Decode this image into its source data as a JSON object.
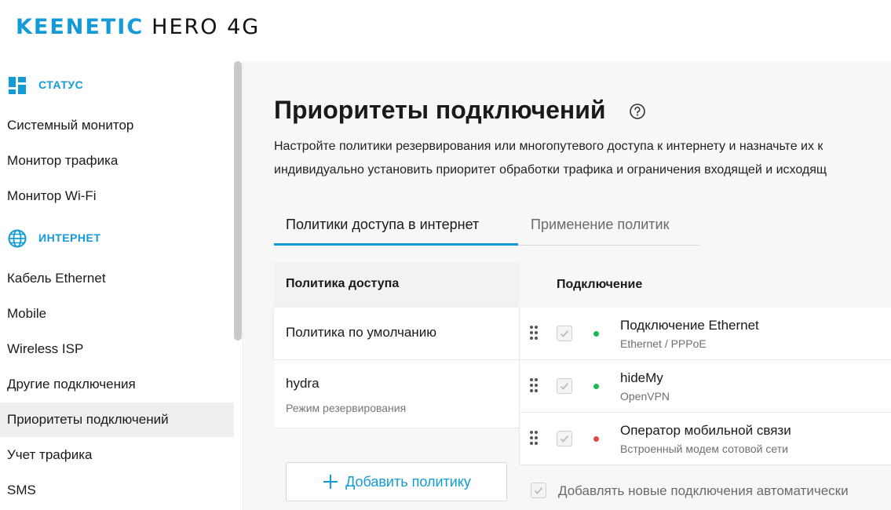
{
  "header": {
    "brand": "KEENETIC",
    "model": "HERO 4G"
  },
  "sidebar": {
    "sections": [
      {
        "label": "СТАТУС",
        "icon": "dashboard-icon",
        "items": [
          {
            "label": "Системный монитор"
          },
          {
            "label": "Монитор трафика"
          },
          {
            "label": "Монитор Wi-Fi"
          }
        ]
      },
      {
        "label": "ИНТЕРНЕТ",
        "icon": "globe-icon",
        "items": [
          {
            "label": "Кабель Ethernet"
          },
          {
            "label": "Mobile"
          },
          {
            "label": "Wireless ISP"
          },
          {
            "label": "Другие подключения"
          },
          {
            "label": "Приоритеты подключений",
            "active": true
          },
          {
            "label": "Учет трафика"
          },
          {
            "label": "SMS"
          }
        ]
      }
    ]
  },
  "main": {
    "title": "Приоритеты подключений",
    "description": [
      "Настройте политики резервирования или многопутевого доступа к интернету и назначьте их к",
      "индивидуально установить приоритет обработки трафика и ограничения входящей и исходящ"
    ],
    "tabs": [
      {
        "label": "Политики доступа в интернет",
        "active": true
      },
      {
        "label": "Применение политик",
        "active": false
      }
    ],
    "policies": {
      "header": "Политика доступа",
      "items": [
        {
          "name": "Политика по умолчанию",
          "sub": ""
        },
        {
          "name": "hydra",
          "sub": "Режим резервирования"
        }
      ],
      "add_label": "Добавить политику"
    },
    "connections": {
      "header": "Подключение",
      "items": [
        {
          "name": "Подключение Ethernet",
          "type": "Ethernet / PPPoE",
          "status_color": "#1db954"
        },
        {
          "name": "hideMy",
          "type": "OpenVPN",
          "status_color": "#1db954"
        },
        {
          "name": "Оператор мобильной связи",
          "type": "Встроенный модем сотовой сети",
          "status_color": "#e04848"
        }
      ],
      "auto_label": "Добавлять новые подключения автоматически"
    }
  },
  "colors": {
    "accent": "#129bd7",
    "online": "#1db954",
    "offline": "#e04848"
  }
}
